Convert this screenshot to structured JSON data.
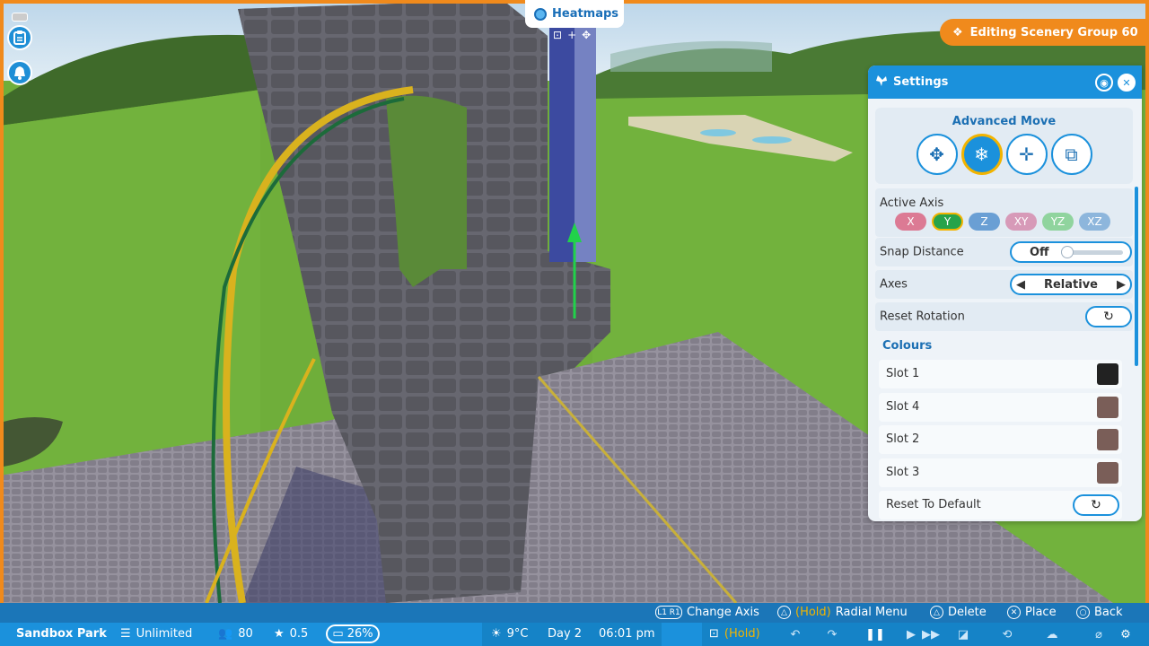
{
  "heatmaps": {
    "label": "Heatmaps",
    "icon": "heatmap-icon"
  },
  "edit_badge": {
    "label": "Editing Scenery Group 60",
    "icon": "scenery-group-icon"
  },
  "settings": {
    "title": "Settings",
    "advanced_move": {
      "title": "Advanced Move",
      "modes": [
        {
          "name": "move-mode-button",
          "icon": "move-arrows-icon",
          "active": false
        },
        {
          "name": "advanced-move-mode-button",
          "icon": "snowflake-move-icon",
          "active": true
        },
        {
          "name": "rotate-mode-button",
          "icon": "rotate-move-icon",
          "active": false
        },
        {
          "name": "scale-mode-button",
          "icon": "resize-icon",
          "active": false
        }
      ]
    },
    "active_axis": {
      "label": "Active Axis",
      "options": [
        "X",
        "Y",
        "Z",
        "XY",
        "YZ",
        "XZ"
      ],
      "selected": "Y"
    },
    "snap_distance": {
      "label": "Snap Distance",
      "value": "Off",
      "level": 0
    },
    "axes": {
      "label": "Axes",
      "value": "Relative"
    },
    "reset_rotation": {
      "label": "Reset Rotation"
    },
    "colours": {
      "title": "Colours",
      "slots": [
        {
          "label": "Slot 1",
          "color": "#222222"
        },
        {
          "label": "Slot 4",
          "color": "#7a5e58"
        },
        {
          "label": "Slot 2",
          "color": "#7a5e58"
        },
        {
          "label": "Slot 3",
          "color": "#7a5e58"
        }
      ],
      "reset_default": "Reset To Default"
    }
  },
  "hints": {
    "change_axis": {
      "button": "L1 R1",
      "label": "Change Axis"
    },
    "radial_menu": {
      "button": "△",
      "hold": "(Hold)",
      "label": "Radial Menu"
    },
    "delete": {
      "button": "△",
      "label": "Delete"
    },
    "place": {
      "button": "✕",
      "label": "Place"
    },
    "back": {
      "button": "○",
      "label": "Back"
    }
  },
  "status": {
    "park_name": "Sandbox Park",
    "money": "Unlimited",
    "guests": "80",
    "rating": "0.5",
    "percent": "26%",
    "temperature": "9°C",
    "day": "Day 2",
    "time": "06:01 pm",
    "hold": "(Hold)"
  },
  "colors": {
    "accent": "#1b91dc",
    "frame": "#f08a1c",
    "active_ring": "#f2b400"
  }
}
